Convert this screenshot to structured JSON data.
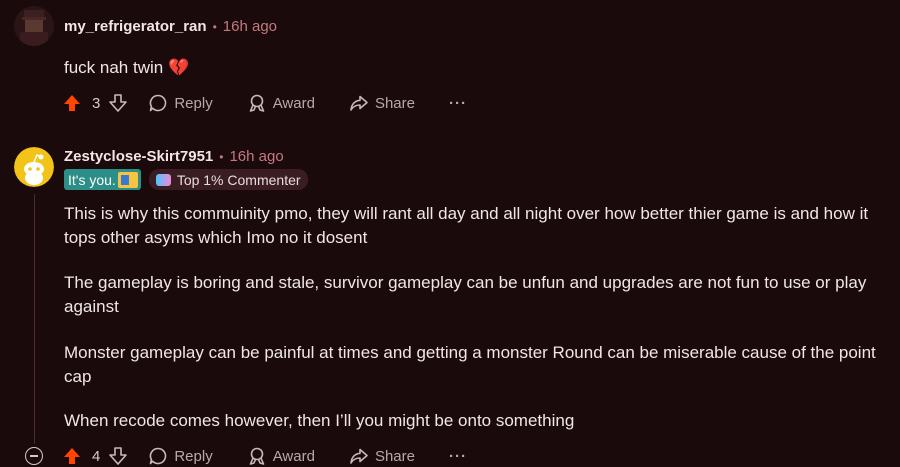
{
  "comment1": {
    "username": "my_refrigerator_ran",
    "separator": "•",
    "time": "16h ago",
    "body": "fuck nah twin",
    "emoji": "💔",
    "votes": "3",
    "reply_label": "Reply",
    "award_label": "Award",
    "share_label": "Share",
    "more_label": "···"
  },
  "comment2": {
    "username": "Zestyclose-Skirt7951",
    "separator": "•",
    "time": "16h ago",
    "flair_user": "It's you.",
    "flair_badge": "Top 1% Commenter",
    "paragraphs": [
      "This is why this commuinity pmo, they will rant all day and all night over how better thier game is and how it tops other asyms which Imo no it dosent",
      "The gameplay is boring and stale, survivor gameplay can be unfun and upgrades are not fun to use or play against",
      "Monster gameplay can be painful at times and getting a monster Round can be miserable cause of the point cap",
      "When recode comes however, then I’ll you might be onto something"
    ],
    "votes": "4",
    "reply_label": "Reply",
    "award_label": "Award",
    "share_label": "Share",
    "more_label": "···"
  },
  "colors": {
    "background": "#1b0a0c",
    "upvote": "#ff4500",
    "timestamp": "#c4797f",
    "flair_teal": "#2c8f87"
  },
  "icons": {
    "upvote": "arrow-up-icon",
    "downvote": "arrow-down-icon",
    "reply": "speech-bubble-icon",
    "award": "award-ribbon-icon",
    "share": "share-arrow-icon",
    "more": "ellipsis-icon",
    "collapse": "collapse-minus-icon"
  }
}
